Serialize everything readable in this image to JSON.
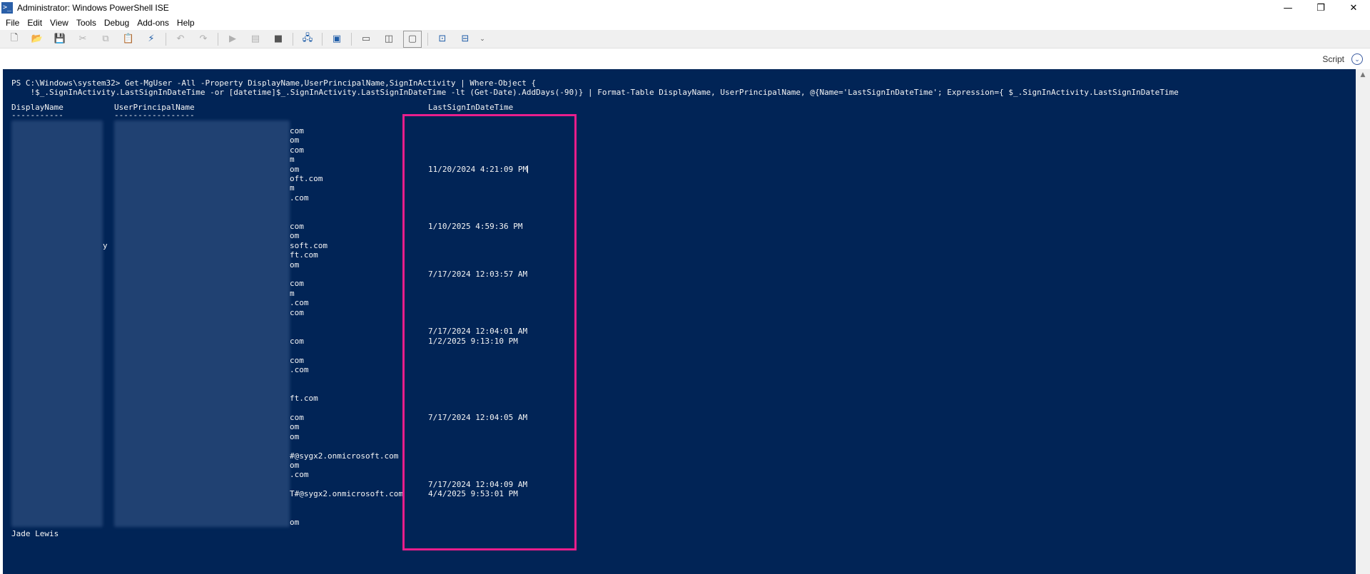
{
  "window": {
    "title": "Administrator: Windows PowerShell ISE",
    "controls": {
      "minimize": "—",
      "restore": "❐",
      "close": "✕"
    }
  },
  "menu": [
    "File",
    "Edit",
    "View",
    "Tools",
    "Debug",
    "Add-ons",
    "Help"
  ],
  "toolbar": {
    "icons": [
      "new-file-icon",
      "open-folder-icon",
      "save-icon",
      "cut-icon",
      "copy-icon",
      "paste-icon",
      "clear-icon",
      "undo-icon",
      "redo-icon",
      "run-icon",
      "run-selection-icon",
      "stop-icon",
      "remote-icon",
      "powershell-icon",
      "layout-top-icon",
      "layout-right-icon",
      "layout-max-icon",
      "show-script-icon",
      "show-commands-icon"
    ]
  },
  "script_pane": {
    "label": "Script"
  },
  "console": {
    "prompt_line": "PS C:\\Windows\\system32> Get-MgUser -All -Property DisplayName,UserPrincipalName,SignInActivity | Where-Object {",
    "continuation_line": "    !$_.SignInActivity.LastSignInDateTime -or [datetime]$_.SignInActivity.LastSignInDateTime -lt (Get-Date).AddDays(-90)} | Format-Table DisplayName, UserPrincipalName, @{Name='LastSignInDateTime'; Expression={ $_.SignInActivity.LastSignInDateTime",
    "headers": [
      "DisplayName",
      "UserPrincipalName",
      "LastSignInDateTime"
    ],
    "underlines": [
      "-----------",
      "-----------------",
      "------------------"
    ],
    "upn_fragments": [
      {
        "row": 0,
        "text": "com"
      },
      {
        "row": 1,
        "text": "om"
      },
      {
        "row": 2,
        "text": "com"
      },
      {
        "row": 3,
        "text": "m"
      },
      {
        "row": 4,
        "text": "om"
      },
      {
        "row": 5,
        "text": "oft.com"
      },
      {
        "row": 6,
        "text": "m"
      },
      {
        "row": 7,
        "text": ".com"
      },
      {
        "row": 10,
        "text": "com"
      },
      {
        "row": 11,
        "text": "om"
      },
      {
        "row": 12,
        "text": "soft.com"
      },
      {
        "row": 13,
        "text": "ft.com"
      },
      {
        "row": 14,
        "text": "om"
      },
      {
        "row": 16,
        "text": "com"
      },
      {
        "row": 17,
        "text": "m"
      },
      {
        "row": 18,
        "text": ".com"
      },
      {
        "row": 19,
        "text": "com"
      },
      {
        "row": 22,
        "text": "com"
      },
      {
        "row": 24,
        "text": "com"
      },
      {
        "row": 25,
        "text": ".com"
      },
      {
        "row": 28,
        "text": "ft.com"
      },
      {
        "row": 30,
        "text": "com"
      },
      {
        "row": 31,
        "text": "om"
      },
      {
        "row": 32,
        "text": "om"
      },
      {
        "row": 34,
        "text": "#@sygx2.onmicrosoft.com"
      },
      {
        "row": 35,
        "text": "om"
      },
      {
        "row": 36,
        "text": ".com"
      },
      {
        "row": 38,
        "text": "T#@sygx2.onmicrosoft.com"
      },
      {
        "row": 41,
        "text": "om"
      }
    ],
    "displayname_fragments": [
      {
        "row": 12,
        "text": "y"
      }
    ],
    "dates": [
      {
        "row": 4,
        "text": "11/20/2024 4:21:09 PM"
      },
      {
        "row": 10,
        "text": "1/10/2025 4:59:36 PM"
      },
      {
        "row": 15,
        "text": "7/17/2024 12:03:57 AM"
      },
      {
        "row": 21,
        "text": "7/17/2024 12:04:01 AM"
      },
      {
        "row": 22,
        "text": "1/2/2025 9:13:10 PM"
      },
      {
        "row": 30,
        "text": "7/17/2024 12:04:05 AM"
      },
      {
        "row": 37,
        "text": "7/17/2024 12:04:09 AM"
      },
      {
        "row": 38,
        "text": "4/4/2025 9:53:01 PM"
      }
    ],
    "last_partial": "Jade Lewis"
  }
}
